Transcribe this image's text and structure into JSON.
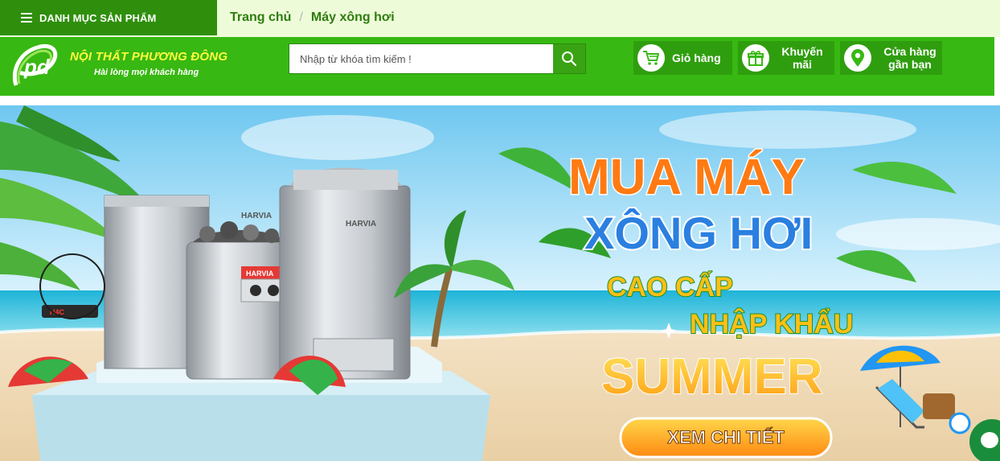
{
  "topbar": {
    "category_label": "DANH MỤC SẢN PHẨM",
    "breadcrumb": [
      {
        "label": "Trang chủ"
      },
      {
        "label": "Máy xông hơi"
      }
    ],
    "separator": "/"
  },
  "header": {
    "logo_text": "pd",
    "brand_name": "NỘI THẤT PHƯƠNG ĐÔNG",
    "slogan": "Hài lòng mọi khách hàng",
    "search": {
      "placeholder": "Nhập từ khóa tìm kiếm !"
    },
    "buttons": {
      "cart": "Giỏ hàng",
      "promo_line1": "Khuyến",
      "promo_line2": "mãi",
      "store_line1": "Cửa hàng",
      "store_line2": "gần bạn"
    }
  },
  "banner": {
    "line1": "MUA MÁY",
    "line2": "XÔNG HƠI",
    "line3": "CAO CẤP",
    "line4": "NHẬP KHẨU",
    "line5": "SUMMER",
    "cta": "XEM CHI TIẾT",
    "product_brand": "HARVIA"
  },
  "colors": {
    "header_green": "#38b812",
    "dark_green": "#2f8f0c",
    "brand_yellow": "#fffb3d",
    "headline_orange": "#ff7a12",
    "headline_blue": "#2a7fe0",
    "summer_yellow": "#ffc21a"
  },
  "icons": [
    "menu-icon",
    "search-icon",
    "cart-icon",
    "gift-icon",
    "location-pin-icon",
    "chat-icon"
  ]
}
